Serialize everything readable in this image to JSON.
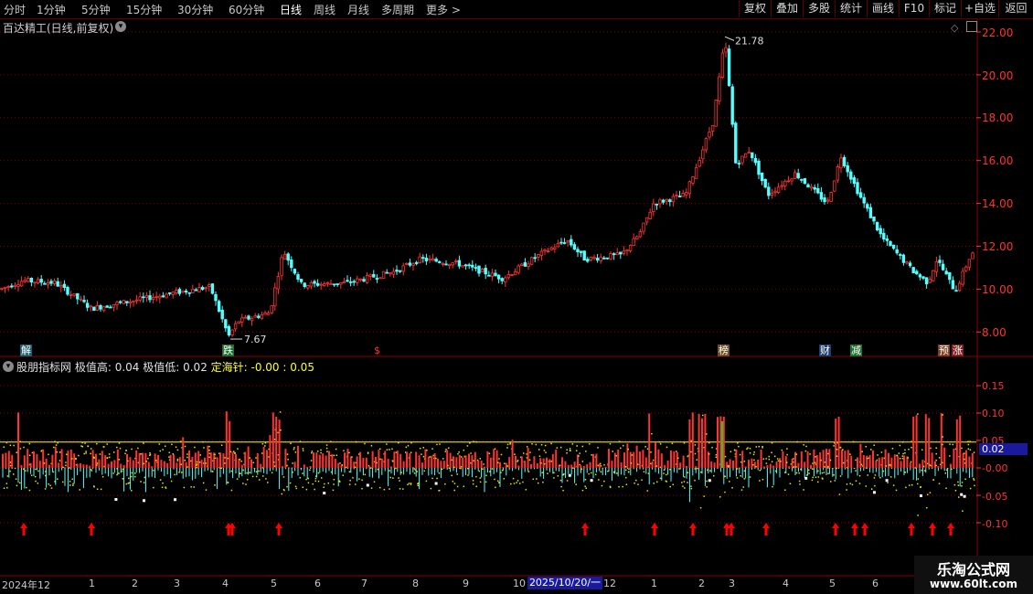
{
  "toolbar": {
    "periods": [
      "分时",
      "1分钟",
      "5分钟",
      "15分钟",
      "30分钟",
      "60分钟",
      "日线",
      "周线",
      "月线",
      "多周期",
      "更多 >"
    ],
    "active_period": "日线",
    "buttons": [
      "复权",
      "叠加",
      "多股",
      "统计",
      "画线",
      "F10",
      "标记",
      "+自选",
      "返回"
    ]
  },
  "main_chart": {
    "title": "百达精工(日线,前复权)",
    "price_ticks": [
      "22.00",
      "20.00",
      "18.00",
      "16.00",
      "14.00",
      "12.00",
      "10.00",
      "8.00"
    ],
    "high_label": "21.78",
    "low_label": "7.67",
    "events": [
      {
        "label": "解",
        "color": "#2aa7c8"
      },
      {
        "label": "跌",
        "color": "#2eaa3a"
      },
      {
        "label": "$",
        "color": "#ff3333"
      },
      {
        "label": "榜",
        "color": "#c08a2a"
      },
      {
        "label": "财",
        "color": "#2a8ad8"
      },
      {
        "label": "减",
        "color": "#2eaa3a"
      },
      {
        "label": "预",
        "color": "#c8642a"
      },
      {
        "label": "涨",
        "color": "#c8322a"
      }
    ]
  },
  "sub_chart": {
    "indicator_name": "股朋指标网",
    "high_label": "极值高: 0.04",
    "low_label": "极值低: 0.02",
    "needle_label": "定海针: -0.00 : 0.05",
    "ticks": [
      "0.15",
      "0.10",
      "0.05",
      "-0.00",
      "-0.05",
      "-0.10"
    ],
    "current_value": "0.02"
  },
  "time_axis": {
    "labels": [
      "2024年12",
      "1",
      "2",
      "3",
      "4",
      "5",
      "6",
      "7",
      "8",
      "9",
      "10",
      "12",
      "1",
      "2",
      "3",
      "4",
      "5",
      "6"
    ],
    "cursor_date": "2025/10/20/一"
  },
  "watermark": {
    "line1": "乐淘公式网",
    "line2": "www.60lt.com"
  },
  "colors": {
    "up": "#ff3333",
    "down": "#54ffff",
    "grid": "#8b0000",
    "yellow_line": "#ffff00",
    "arrow": "#ff0000"
  }
}
